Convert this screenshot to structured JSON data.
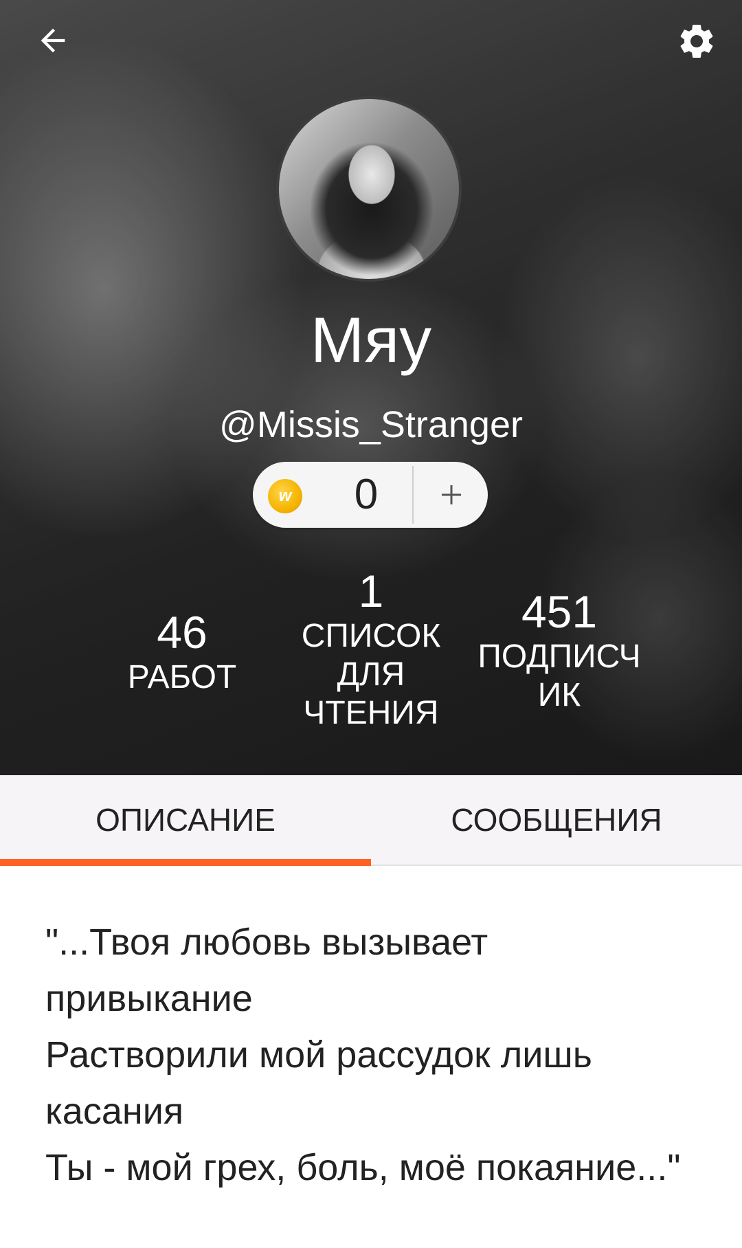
{
  "header": {
    "back_icon": "arrow-left-icon",
    "settings_icon": "gear-icon",
    "display_name": "Мяу",
    "username": "@Missis_Stranger"
  },
  "coins": {
    "icon": "wattpad-coin-icon",
    "count": "0",
    "add_label": "+"
  },
  "stats": {
    "works": {
      "count": "46",
      "label": "РАБОТ"
    },
    "reading_lists": {
      "count": "1",
      "label": "СПИСОК ДЛЯ ЧТЕНИЯ"
    },
    "followers": {
      "count": "451",
      "label": "ПОДПИСЧИК"
    }
  },
  "tabs": [
    {
      "label": "ОПИСАНИЕ",
      "active": true
    },
    {
      "label": "СООБЩЕНИЯ",
      "active": false
    }
  ],
  "description": "\"...Твоя любовь вызывает привыкание\nРастворили мой рассудок лишь касания\nТы - мой грех, боль, моё покаяние...\"",
  "colors": {
    "accent": "#ff6122",
    "tab_bar_bg": "#f6f4f6",
    "coin": "#f5b400"
  }
}
